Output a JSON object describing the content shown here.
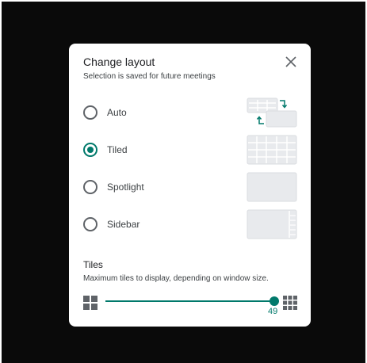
{
  "dialog": {
    "title": "Change layout",
    "subtitle": "Selection is saved for future meetings",
    "close_icon": "close-icon"
  },
  "options": [
    {
      "label": "Auto",
      "selected": false
    },
    {
      "label": "Tiled",
      "selected": true
    },
    {
      "label": "Spotlight",
      "selected": false
    },
    {
      "label": "Sidebar",
      "selected": false
    }
  ],
  "tiles": {
    "heading": "Tiles",
    "description": "Maximum tiles to display, depending on window size.",
    "value": "49",
    "slider_fraction": 1.0
  },
  "colors": {
    "accent": "#00796b",
    "backdrop": "#0a0a0a",
    "thumb_fill": "#e8eaed",
    "thumb_border": "#dadce0"
  }
}
